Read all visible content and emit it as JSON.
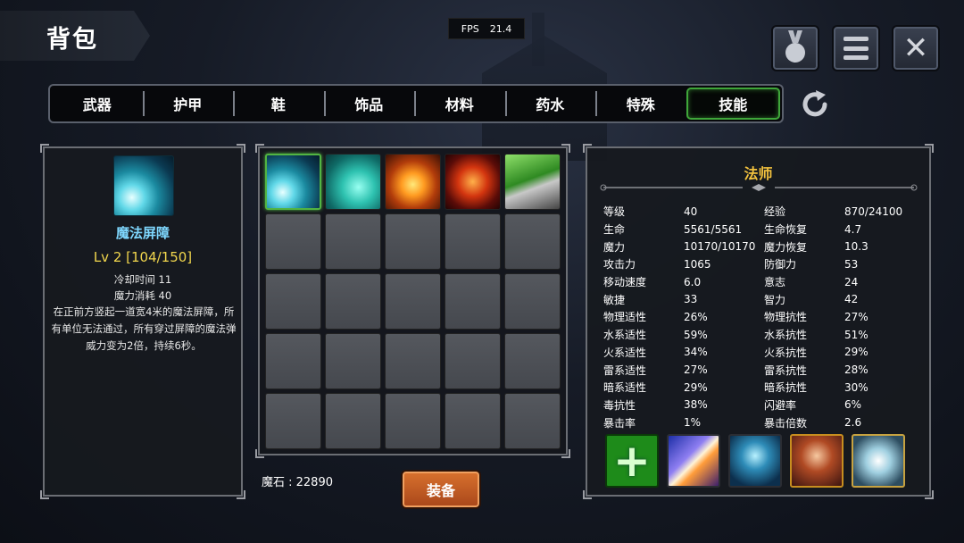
{
  "header": {
    "title": "背包",
    "fps_label": "FPS",
    "fps_value": "21.4"
  },
  "top_buttons": [
    {
      "icon": "medal-icon"
    },
    {
      "icon": "menu-icon"
    },
    {
      "icon": "close-icon"
    }
  ],
  "tabs": [
    {
      "label": "武器",
      "active": false
    },
    {
      "label": "护甲",
      "active": false
    },
    {
      "label": "鞋",
      "active": false
    },
    {
      "label": "饰品",
      "active": false
    },
    {
      "label": "材料",
      "active": false
    },
    {
      "label": "药水",
      "active": false
    },
    {
      "label": "特殊",
      "active": false
    },
    {
      "label": "技能",
      "active": true
    }
  ],
  "skill_detail": {
    "name": "魔法屏障",
    "level": "Lv 2 [104/150]",
    "cooldown": "冷却时间 11",
    "mana_cost": "魔力消耗 40",
    "description": "在正前方竖起一道宽4米的魔法屏障，所有单位无法通过，所有穿过屏障的魔法弹威力变为2倍，持续6秒。"
  },
  "inventory": {
    "stone_label": "魔石 : 22890",
    "equip_label": "装备",
    "filled_slots": 5,
    "total_slots": 25
  },
  "stats": {
    "class_name": "法师",
    "rows": [
      [
        "等级",
        "40",
        "经验",
        "870/24100"
      ],
      [
        "生命",
        "5561/5561",
        "生命恢复",
        "4.7"
      ],
      [
        "魔力",
        "10170/10170",
        "魔力恢复",
        "10.3"
      ],
      [
        "攻击力",
        "1065",
        "防御力",
        "53"
      ],
      [
        "移动速度",
        "6.0",
        "意志",
        "24"
      ],
      [
        "敏捷",
        "33",
        "智力",
        "42"
      ],
      [
        "物理适性",
        "26%",
        "物理抗性",
        "27%"
      ],
      [
        "水系适性",
        "59%",
        "水系抗性",
        "51%"
      ],
      [
        "火系适性",
        "34%",
        "火系抗性",
        "29%"
      ],
      [
        "雷系适性",
        "27%",
        "雷系抗性",
        "28%"
      ],
      [
        "暗系适性",
        "29%",
        "暗系抗性",
        "30%"
      ],
      [
        "毒抗性",
        "38%",
        "闪避率",
        "6%"
      ],
      [
        "暴击率",
        "1%",
        "暴击倍数",
        "2.6"
      ]
    ]
  },
  "colors": {
    "active_tab": "#3fa63a",
    "skill_name": "#7fd8ff",
    "level": "#f1d64d",
    "class_name": "#f3c23e",
    "equip_button": "#c25a22"
  }
}
